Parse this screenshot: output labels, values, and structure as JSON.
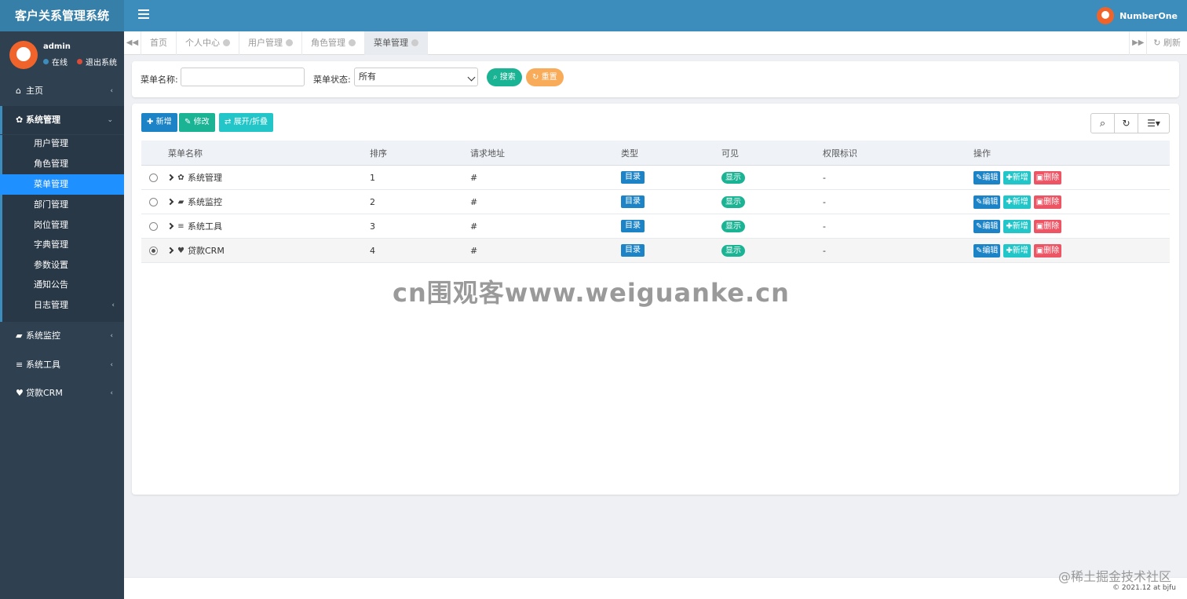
{
  "app": {
    "title": "客户关系管理系统",
    "user_top": "NumberOne"
  },
  "user": {
    "name": "admin",
    "status": "在线",
    "logout": "退出系统"
  },
  "sidebar": {
    "home": "主页",
    "system": "系统管理",
    "sub_items": [
      "用户管理",
      "角色管理",
      "菜单管理",
      "部门管理",
      "岗位管理",
      "字典管理",
      "参数设置",
      "通知公告",
      "日志管理"
    ],
    "monitor": "系统监控",
    "tools": "系统工具",
    "crm": "贷款CRM"
  },
  "tabs": [
    "首页",
    "个人中心",
    "用户管理",
    "角色管理",
    "菜单管理"
  ],
  "refresh_label": "刷新",
  "search": {
    "name_label": "菜单名称:",
    "name_value": "",
    "status_label": "菜单状态:",
    "status_value": "所有",
    "search_btn": "搜索",
    "reset_btn": "重置"
  },
  "toolbar": {
    "add": "新增",
    "edit": "修改",
    "expand": "展开/折叠"
  },
  "table": {
    "headers": [
      "菜单名称",
      "排序",
      "请求地址",
      "类型",
      "可见",
      "权限标识",
      "操作"
    ],
    "rows": [
      {
        "icon": "gear-icon",
        "glyph": "✿",
        "name": "系统管理",
        "order": "1",
        "url": "#",
        "type": "目录",
        "visible": "显示",
        "perm": "-"
      },
      {
        "icon": "video-icon",
        "glyph": "▰",
        "name": "系统监控",
        "order": "2",
        "url": "#",
        "type": "目录",
        "visible": "显示",
        "perm": "-"
      },
      {
        "icon": "bars-icon",
        "glyph": "≡",
        "name": "系统工具",
        "order": "3",
        "url": "#",
        "type": "目录",
        "visible": "显示",
        "perm": "-"
      },
      {
        "icon": "heart-icon",
        "glyph": "♥",
        "name": "贷款CRM",
        "order": "4",
        "url": "#",
        "type": "目录",
        "visible": "显示",
        "perm": "-"
      }
    ],
    "actions": {
      "edit": "编辑",
      "add": "新增",
      "delete": "删除"
    },
    "selected_row": 4
  },
  "watermark": "cn围观客www.weiguanke.cn",
  "footer": {
    "copyright": "© 2021.12 at bjfu",
    "juejin": "@稀土掘金技术社区"
  },
  "colors": {
    "header": "#3c8dbc",
    "sidebar": "#2f4050",
    "active_menu": "#1e90ff",
    "primary": "#1c84c6",
    "success": "#1ab394",
    "info": "#23c6c8",
    "warning": "#f8ac59",
    "danger": "#ed5565"
  }
}
